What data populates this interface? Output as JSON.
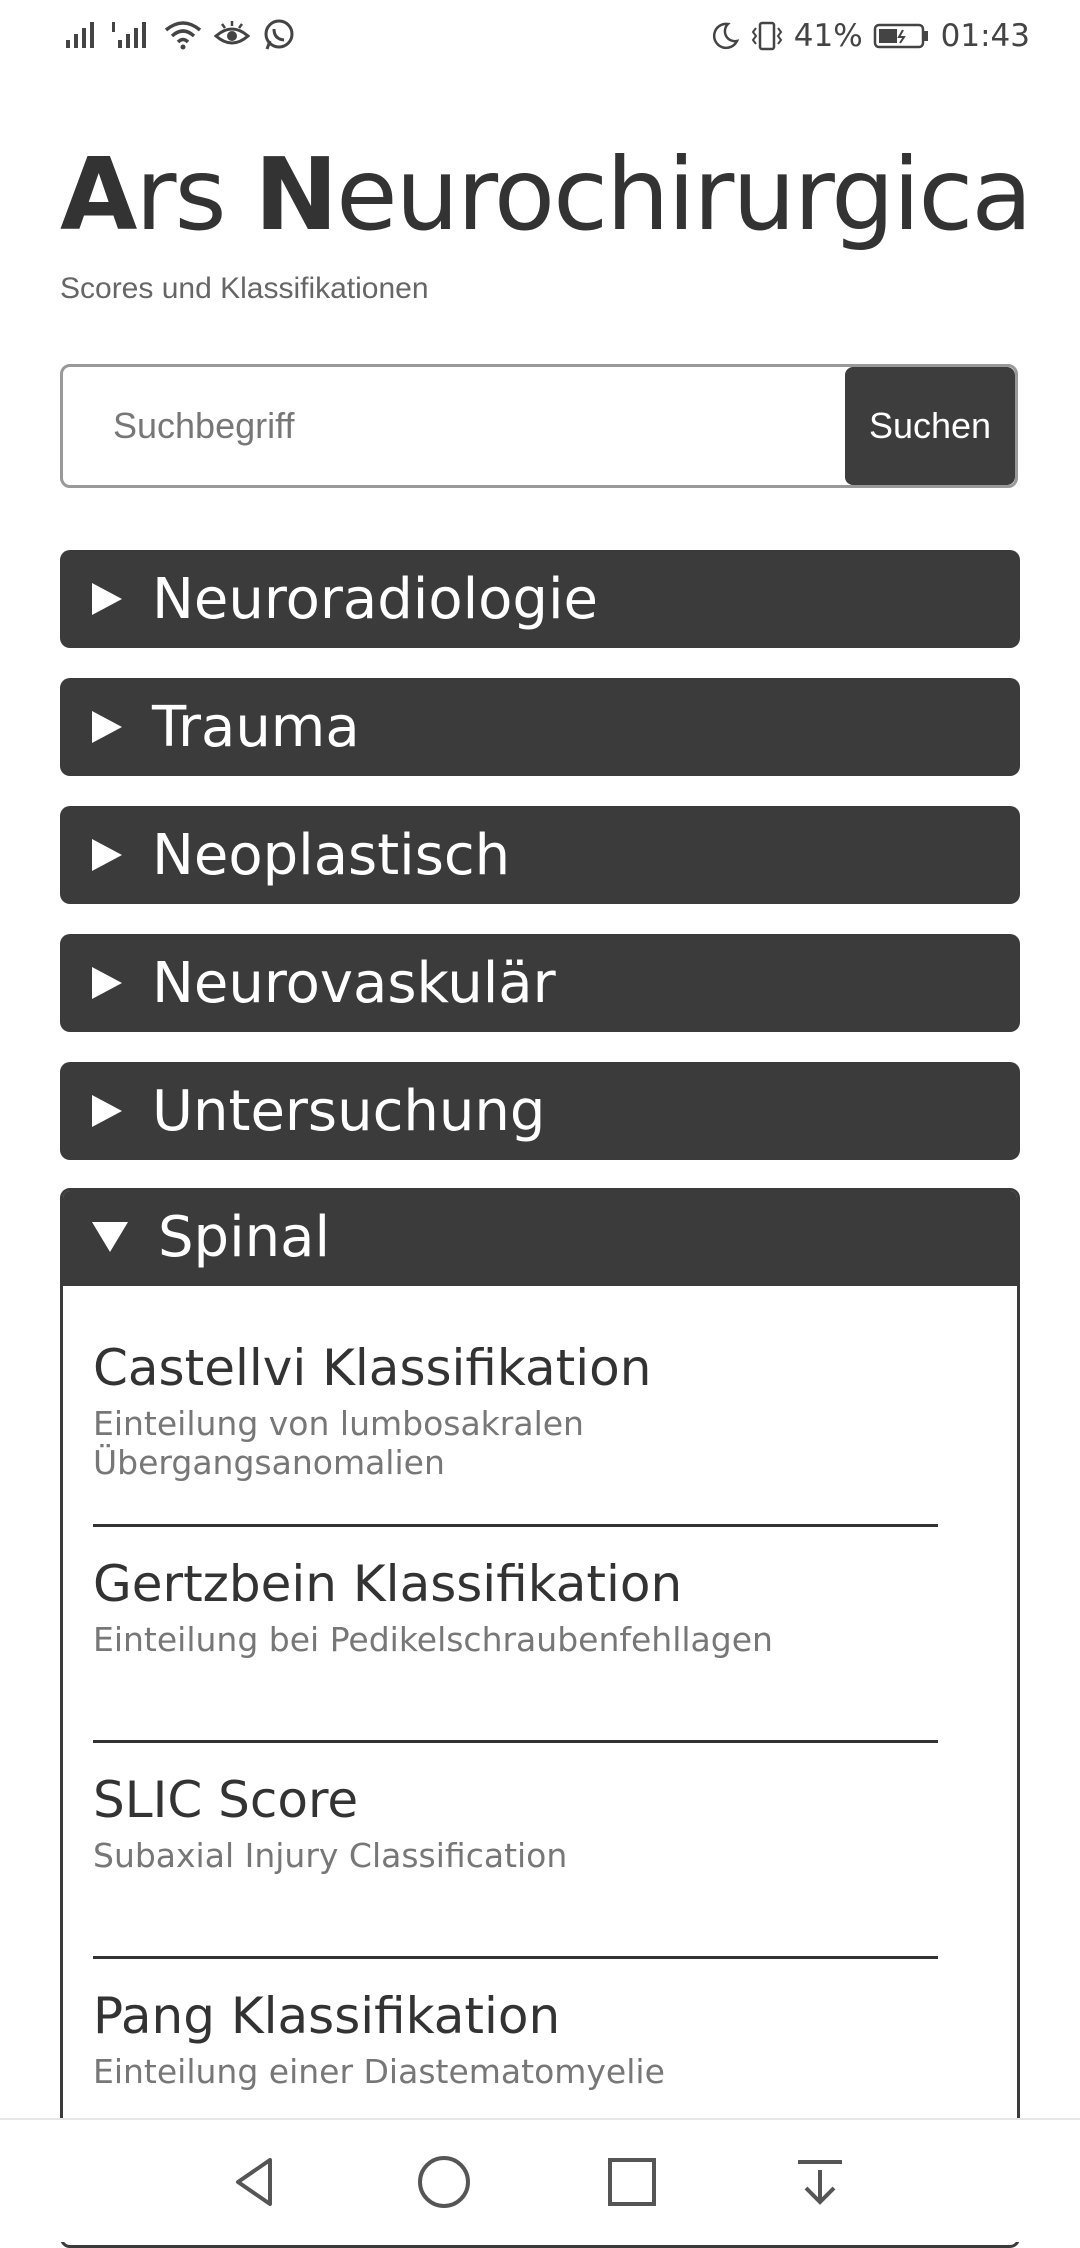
{
  "status_bar": {
    "battery": "41%",
    "time": "01:43"
  },
  "header": {
    "title_bold1": "A",
    "title_rest1": "rs ",
    "title_bold2": "N",
    "title_rest2": "eurochirurgica",
    "subtitle": "Scores und Klassifikationen"
  },
  "search": {
    "placeholder": "Suchbegriff",
    "button_label": "Suchen"
  },
  "categories": [
    {
      "label": "Neuroradiologie"
    },
    {
      "label": "Trauma"
    },
    {
      "label": "Neoplastisch"
    },
    {
      "label": "Neurovaskulär"
    },
    {
      "label": "Untersuchung"
    },
    {
      "label": "Spinal"
    }
  ],
  "spinal_items": [
    {
      "title": "Castellvi Klassifikation",
      "desc": "Einteilung von lumbosakralen Übergangsanomalien"
    },
    {
      "title": "Gertzbein Klassifikation",
      "desc": "Einteilung bei Pedikelschraubenfehllagen"
    },
    {
      "title": "SLIC Score",
      "desc": "Subaxial Injury Classification"
    },
    {
      "title": "Pang Klassifikation",
      "desc": "Einteilung einer Diastematomyelie"
    }
  ],
  "icons": {
    "status_left": [
      "signal-icon",
      "signal-icon",
      "wifi-icon",
      "eye-icon",
      "whatsapp-icon"
    ],
    "status_right": [
      "moon-icon",
      "vibrate-icon",
      "battery-icon"
    ],
    "nav": [
      "back-icon",
      "home-icon",
      "recents-icon",
      "notification-pulldown-icon"
    ]
  }
}
